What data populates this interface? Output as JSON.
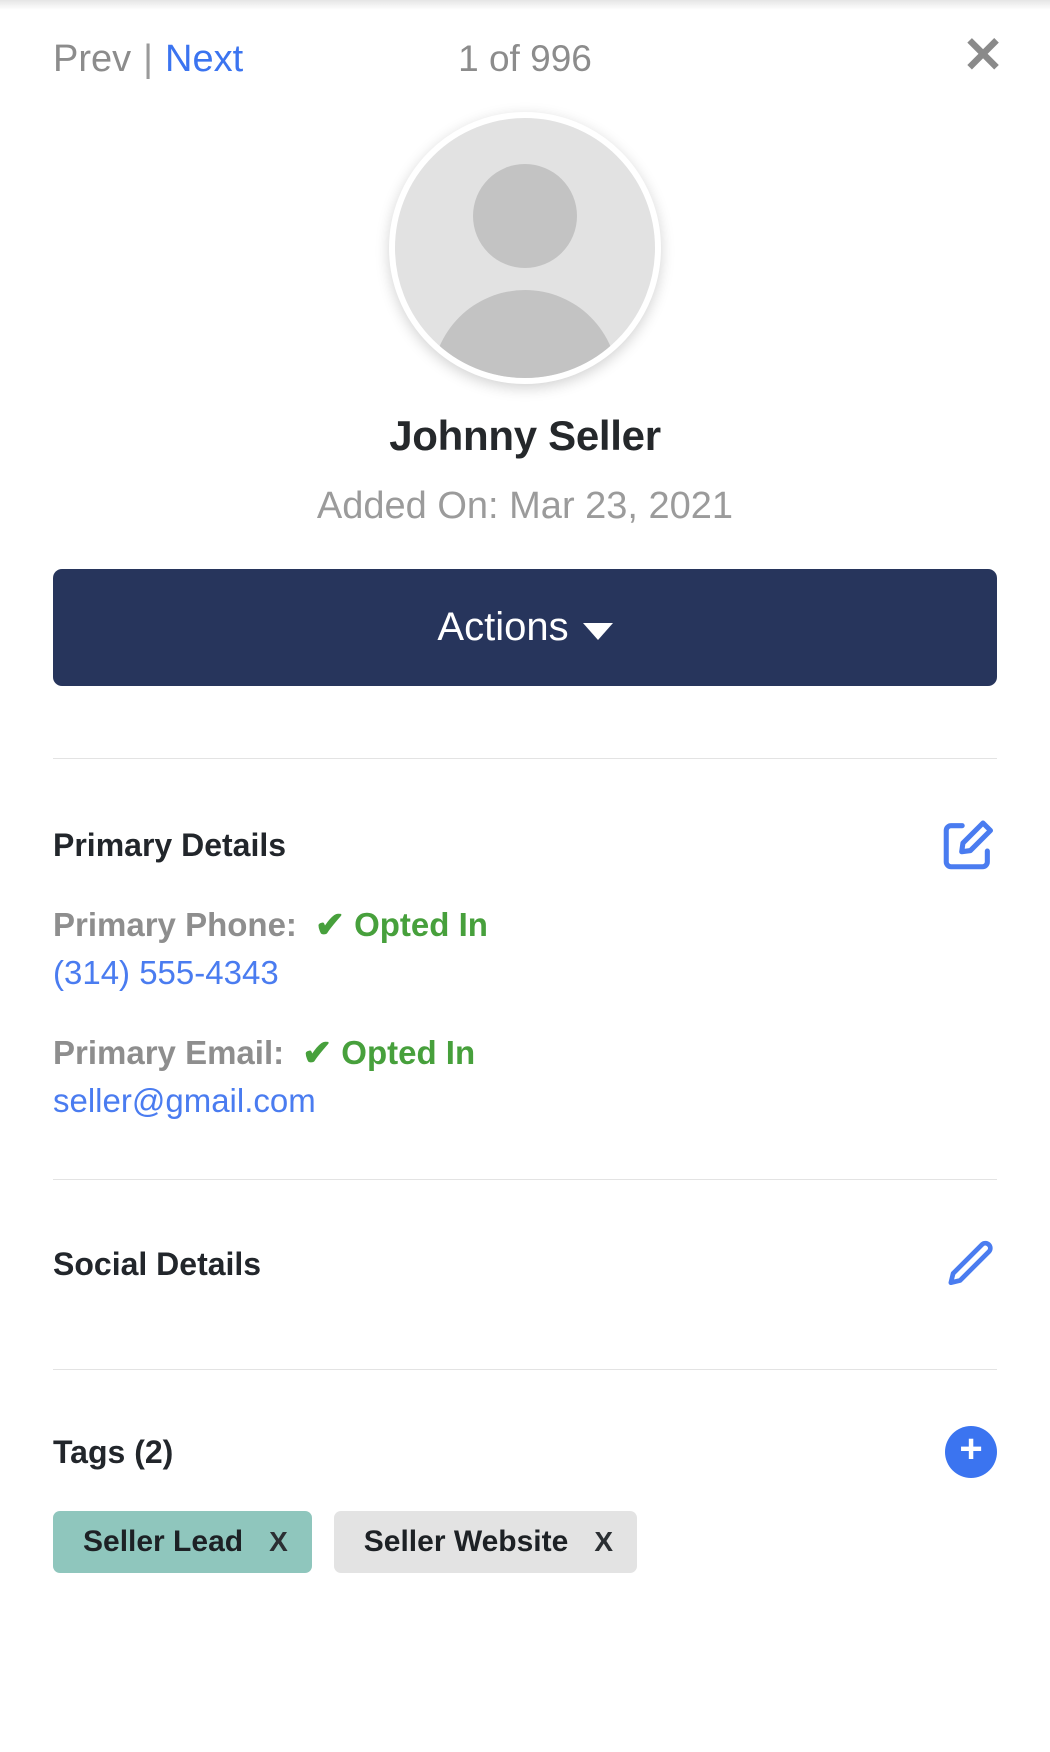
{
  "header": {
    "prev_label": "Prev",
    "separator": "|",
    "next_label": "Next",
    "counter": "1 of 996",
    "close_label": "✕"
  },
  "profile": {
    "avatar_alt": "contact-avatar-placeholder",
    "name": "Johnny Seller",
    "added_on": "Added On: Mar 23, 2021"
  },
  "actions": {
    "label": "Actions"
  },
  "primary_details": {
    "title": "Primary Details",
    "edit_icon": "edit-square-icon",
    "fields": [
      {
        "label": "Primary Phone:",
        "status": "Opted In",
        "status_icon": "check-icon",
        "value": "(314) 555-4343"
      },
      {
        "label": "Primary Email:",
        "status": "Opted In",
        "status_icon": "check-icon",
        "value": "seller@gmail.com"
      }
    ]
  },
  "social_details": {
    "title": "Social Details",
    "edit_icon": "pencil-icon"
  },
  "tags": {
    "title": "Tags (2)",
    "add_icon": "plus-circle-icon",
    "items": [
      {
        "label": "Seller Lead",
        "remove": "X",
        "color": "#8fc6bd"
      },
      {
        "label": "Seller Website",
        "remove": "X",
        "color": "#e3e3e3"
      }
    ]
  },
  "colors": {
    "navy": "#27355c",
    "link_blue": "#3b74f0",
    "green": "#47a03c",
    "gray_text": "#8e8e8e",
    "tag_teal": "#8fc6bd",
    "tag_gray": "#e3e3e3"
  }
}
